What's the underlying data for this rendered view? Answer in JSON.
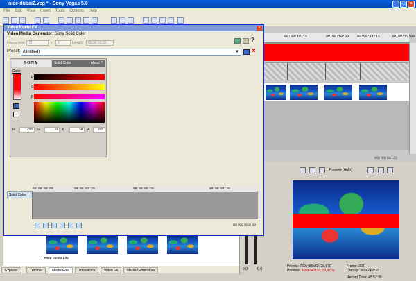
{
  "window": {
    "title": "nice-dubai2.veg * - Sony Vegas 5.0"
  },
  "menu": [
    "File",
    "Edit",
    "View",
    "Insert",
    "Tools",
    "Options",
    "Help"
  ],
  "timeline": {
    "ruler_labels": [
      "00:00:10:15",
      "00:00:10:00",
      "00:00:11:15",
      "00:00:12:00"
    ],
    "cursor_time": "00:00:06:22"
  },
  "fx": {
    "title": "Video Event FX",
    "header_prefix": "Video Media Generator:",
    "header_value": "Sony Solid Color",
    "frame_size_label": "Frame size:",
    "frame_w": "72",
    "frame_x": "x",
    "frame_h": "8",
    "length_label": "Length:",
    "length_value": "00:00:10:00",
    "preset_label": "Preset:",
    "preset_value": "(Untitled)",
    "plugin_brand": "SONY",
    "plugin_name": "Solid Color",
    "about_label": "About ?",
    "color_label": "Color",
    "channels": [
      {
        "label": "R",
        "value": "255"
      },
      {
        "label": "G",
        "value": "0"
      },
      {
        "label": "B",
        "value": "14"
      },
      {
        "label": "A",
        "value": "255"
      }
    ],
    "rgb_side_labels": [
      "R",
      "G",
      "B"
    ],
    "track_label": "Solid Color",
    "kf_times": [
      "00:00:00:00",
      "00:00:02:29",
      "00:00:05:29",
      "00:00:07:29"
    ],
    "kf_time_display": "00:00:00:00",
    "accent_red": "#ff0000"
  },
  "media_pool": {
    "offline_label": "Offline Media File"
  },
  "tabs": [
    "Explorer",
    "Trimmer",
    "Media Pool",
    "Transitions",
    "Video FX",
    "Media Generators"
  ],
  "preview": {
    "mode": "Preview (Auto)",
    "project_label": "Project:",
    "project_value": "720x480x32; 29,970",
    "preview_label": "Preview:",
    "preview_value": "360x240x32; 29,970p",
    "frame_label": "Frame:",
    "frame_value": "202",
    "display_label": "Display:",
    "display_value": "360x240x32"
  },
  "mixer_values": [
    "0,0",
    "0,0"
  ],
  "status": {
    "record_time": "Record Time: 45:52:30"
  }
}
